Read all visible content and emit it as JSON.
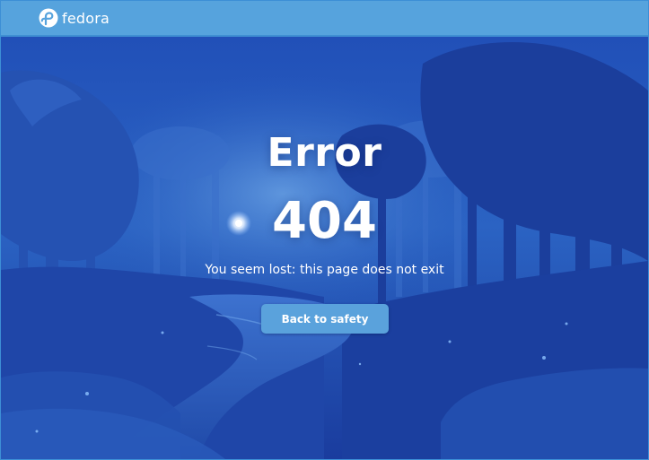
{
  "header": {
    "logo_text": "fedora",
    "logo_icon": "fedora-infinity-icon"
  },
  "error": {
    "title": "Error",
    "code": "404",
    "message": "You seem lost: this page does not exit"
  },
  "actions": {
    "back_label": "Back to safety"
  },
  "colors": {
    "header_bg": "#56a3dd",
    "button_bg": "#5aa2dc",
    "scene_bg": "#1d43a8",
    "text": "#ffffff"
  }
}
